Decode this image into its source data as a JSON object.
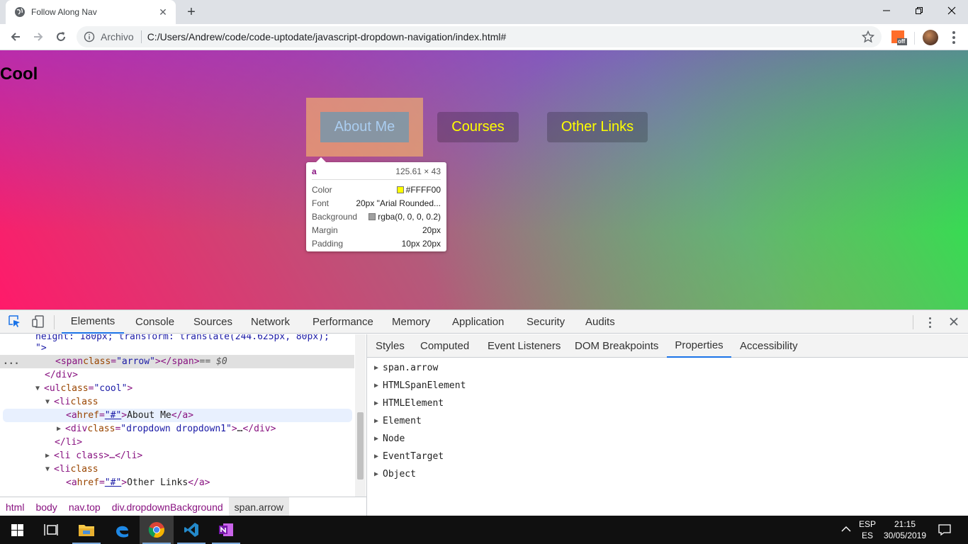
{
  "browser": {
    "tab_title": "Follow Along Nav",
    "address_prefix": "Archivo",
    "address_url": "C:/Users/Andrew/code/code-uptodate/javascript-dropdown-navigation/index.html#",
    "extension_badge": "off"
  },
  "page": {
    "title": "Cool",
    "nav": [
      "About Me",
      "Courses",
      "Other Links"
    ],
    "colors": {
      "link_text": "#FFFF00",
      "margin_highlight": "#F6B26B",
      "content_highlight": "#7896AA"
    }
  },
  "tooltip": {
    "tag": "a",
    "size": "125.61 × 43",
    "rows": [
      {
        "label": "Color",
        "value": "#FFFF00",
        "swatch": "#ffff00"
      },
      {
        "label": "Font",
        "value": "20px \"Arial Rounded...",
        "swatch": null
      },
      {
        "label": "Background",
        "value": "rgba(0, 0, 0, 0.2)",
        "swatch": "#a0a0a0"
      },
      {
        "label": "Margin",
        "value": "20px",
        "swatch": null
      },
      {
        "label": "Padding",
        "value": "10px 20px",
        "swatch": null
      }
    ]
  },
  "devtools": {
    "tabs": [
      "Elements",
      "Console",
      "Sources",
      "Network",
      "Performance",
      "Memory",
      "Application",
      "Security",
      "Audits"
    ],
    "active_tab": "Elements",
    "elements": {
      "line0": "height: 180px; transform: translate(244.625px, 80px);",
      "line1": "\">",
      "span_tag_open": "<span ",
      "span_attr": "class",
      "span_val": "\"arrow\"",
      "span_tag_close": "></span>",
      "span_eq": " == $0",
      "div_close": "</div>",
      "ul_open": "<ul ",
      "ul_attr": "class",
      "ul_val": "\"cool\"",
      "li_open": "<li ",
      "li_attr": "class",
      "a_open": "<a ",
      "a_attr": "href",
      "a_val": "\"#\"",
      "a_text1": "About Me",
      "a_close": "</a>",
      "div_open": "<div ",
      "div_attr": "class",
      "div_val": "\"dropdown dropdown1\"",
      "ellipsis": "…",
      "li_close": "</li>",
      "li_collapsed": "<li class>…</li>",
      "a_text2": "Other Links",
      "ellipsis_dots": "..."
    },
    "breadcrumbs": [
      "html",
      "body",
      "nav.top",
      "div.dropdownBackground",
      "span.arrow"
    ],
    "side_tabs": [
      "Styles",
      "Computed",
      "Event Listeners",
      "DOM Breakpoints",
      "Properties",
      "Accessibility"
    ],
    "active_side_tab": "Properties",
    "properties": [
      "span.arrow",
      "HTMLSpanElement",
      "HTMLElement",
      "Element",
      "Node",
      "EventTarget",
      "Object"
    ]
  },
  "taskbar": {
    "lang_top": "ESP",
    "lang_bottom": "ES",
    "time": "21:15",
    "date": "30/05/2019"
  }
}
